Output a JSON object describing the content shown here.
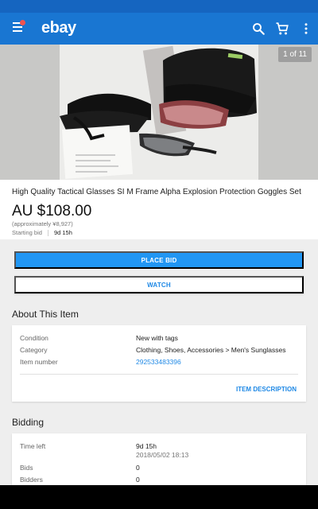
{
  "header": {
    "logo": "ebay"
  },
  "gallery": {
    "counter": "1 of 11"
  },
  "listing": {
    "title": "High Quality Tactical Glasses SI M Frame Alpha Explosion Protection Goggles Set",
    "price": "AU $108.00",
    "approx": "(approximately ¥8,927)",
    "starting_label": "Starting bid",
    "time_short": "9d 15h"
  },
  "buttons": {
    "place_bid": "PLACE BID",
    "watch": "WATCH"
  },
  "about": {
    "title": "About This Item",
    "rows": [
      {
        "label": "Condition",
        "value": "New with tags"
      },
      {
        "label": "Category",
        "value": "Clothing, Shoes, Accessories > Men's Sunglasses"
      },
      {
        "label": "Item number",
        "value": "292533483396"
      }
    ],
    "description_link": "ITEM DESCRIPTION"
  },
  "bidding": {
    "title": "Bidding",
    "rows": [
      {
        "label": "Time left",
        "value": "9d 15h",
        "sub": "2018/05/02 18:13"
      },
      {
        "label": "Bids",
        "value": "0"
      },
      {
        "label": "Bidders",
        "value": "0"
      }
    ]
  },
  "colors": {
    "app_bar": "#1976d2",
    "status_bar": "#1565c0",
    "primary": "#2196f3",
    "link": "#1e88e5"
  },
  "icons": [
    "menu-icon",
    "search-icon",
    "cart-icon",
    "more-vert-icon"
  ]
}
